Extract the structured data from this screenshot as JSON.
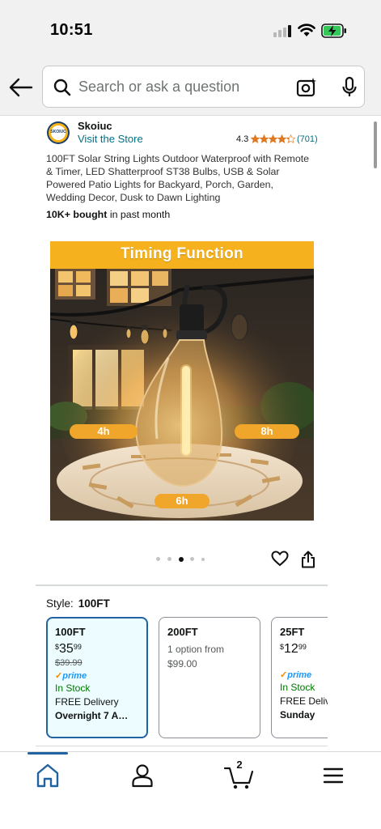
{
  "status_bar": {
    "time": "10:51"
  },
  "search": {
    "placeholder": "Search or ask a question"
  },
  "store": {
    "logo_text": "SKOIUC",
    "name": "Skoiuc",
    "visit_label": "Visit the Store",
    "rating": "4.3",
    "rating_count": "(701)",
    "stars_value": 4.3
  },
  "product": {
    "title": "100FT Solar String Lights Outdoor Waterproof with Remote & Timer, LED Shatterproof ST38 Bulbs, USB & Solar Powered Patio Lights for Backyard, Porch, Garden, Wedding Decor, Dusk to Dawn Lighting",
    "bought_bold": "10K+ bought",
    "bought_rest": " in past month",
    "image": {
      "banner": "Timing Function",
      "tag_left": "4h",
      "tag_right": "8h",
      "tag_bottom": "6h"
    },
    "carousel": {
      "total": 5,
      "active_index": 2
    }
  },
  "style": {
    "label": "Style:",
    "selected": "100FT",
    "options": [
      {
        "name": "100FT",
        "price_symbol": "$",
        "price_whole": "35",
        "price_fraction": "99",
        "list_price": "$39.99",
        "prime": "prime",
        "stock": "In Stock",
        "delivery": "FREE Delivery",
        "date": "Overnight 7 A…"
      },
      {
        "name": "200FT",
        "sub_line1": "1 option from",
        "sub_line2": "$99.00"
      },
      {
        "name": "25FT",
        "price_symbol": "$",
        "price_whole": "12",
        "price_fraction": "99",
        "prime": "prime",
        "stock": "In Stock",
        "delivery": "FREE Deliv",
        "date": "Sunday"
      }
    ]
  },
  "bottom_nav": {
    "cart_count": "2",
    "items": [
      "home-icon",
      "account-icon",
      "cart-icon",
      "menu-icon"
    ]
  },
  "colors": {
    "link": "#007185",
    "selected_border": "#2162a1",
    "in_stock": "#007600",
    "star": "#de7921",
    "banner": "#f5b21e"
  }
}
